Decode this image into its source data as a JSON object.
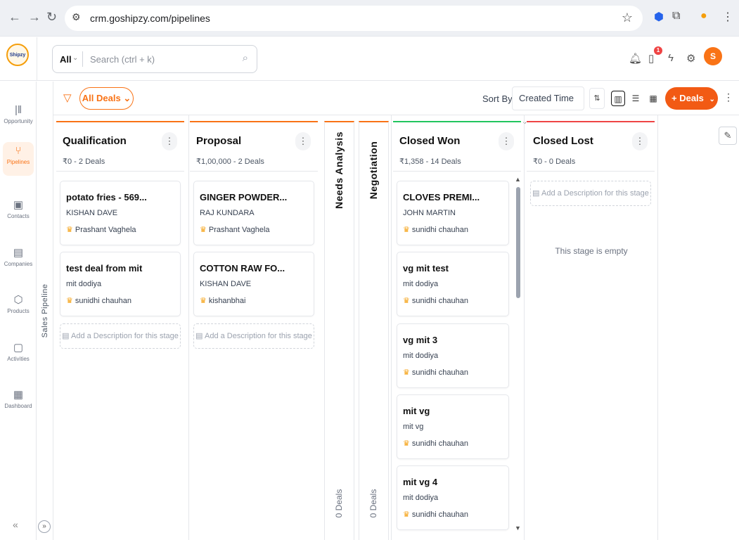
{
  "browser": {
    "url": "crm.goshipzy.com/pipelines"
  },
  "header": {
    "logo_text": "Shipzy",
    "search_scope": "All",
    "search_placeholder": "Search (ctrl + k)",
    "notification_count": "1",
    "avatar_initial": "S"
  },
  "sidebar": {
    "items": [
      {
        "label": "Opportunity",
        "icon": "bar-chart-icon",
        "glyph": "|‖"
      },
      {
        "label": "Pipelines",
        "icon": "pipeline-icon",
        "glyph": "⑂",
        "active": true
      },
      {
        "label": "Contacts",
        "icon": "contacts-icon",
        "glyph": "▣"
      },
      {
        "label": "Companies",
        "icon": "building-icon",
        "glyph": "▤"
      },
      {
        "label": "Products",
        "icon": "box-icon",
        "glyph": "⬡"
      },
      {
        "label": "Activities",
        "icon": "clipboard-icon",
        "glyph": "▢"
      },
      {
        "label": "Dashboard",
        "icon": "dashboard-icon",
        "glyph": "▦"
      }
    ]
  },
  "pipeline_label": "Sales Pipeline",
  "toolbar": {
    "filter_label": "All Deals",
    "sort_by_label": "Sort By",
    "sort_value": "Created Time",
    "add_button_label": "+ Deals"
  },
  "stages": {
    "qualification": {
      "title": "Qualification",
      "summary": "₹0 - 2 Deals",
      "cards": [
        {
          "title": "potato fries - 569...",
          "person": "KISHAN DAVE",
          "owner": "Prashant Vaghela"
        },
        {
          "title": "test deal from mit",
          "person": "mit dodiya",
          "owner": "sunidhi chauhan"
        }
      ],
      "add_description": "Add a Description for this stage"
    },
    "proposal": {
      "title": "Proposal",
      "summary": "₹1,00,000 - 2 Deals",
      "cards": [
        {
          "title": "GINGER POWDER...",
          "person": "RAJ KUNDARA",
          "owner": "Prashant Vaghela"
        },
        {
          "title": "COTTON RAW FO...",
          "person": "KISHAN DAVE",
          "owner": "kishanbhai"
        }
      ],
      "add_description": "Add a Description for this stage"
    },
    "needs_analysis": {
      "title": "Needs Analysis",
      "count": "0 Deals"
    },
    "negotiation": {
      "title": "Negotiation",
      "count": "0 Deals"
    },
    "closed_won": {
      "title": "Closed Won",
      "summary": "₹1,358 - 14 Deals",
      "cards": [
        {
          "title": "CLOVES PREMI...",
          "person": "JOHN MARTIN",
          "owner": "sunidhi chauhan"
        },
        {
          "title": "vg mit test",
          "person": "mit dodiya",
          "owner": "sunidhi chauhan"
        },
        {
          "title": "vg mit 3",
          "person": "mit dodiya",
          "owner": "sunidhi chauhan"
        },
        {
          "title": "mit vg",
          "person": "mit vg",
          "owner": "sunidhi chauhan"
        },
        {
          "title": "mit vg 4",
          "person": "mit dodiya",
          "owner": "sunidhi chauhan"
        }
      ]
    },
    "closed_lost": {
      "title": "Closed Lost",
      "summary": "₹0 - 0 Deals",
      "add_description": "Add a Description for this stage",
      "empty_text": "This stage is empty"
    }
  },
  "colors": {
    "accent": "#f97316",
    "won": "#22c55e",
    "lost": "#ef4444"
  }
}
